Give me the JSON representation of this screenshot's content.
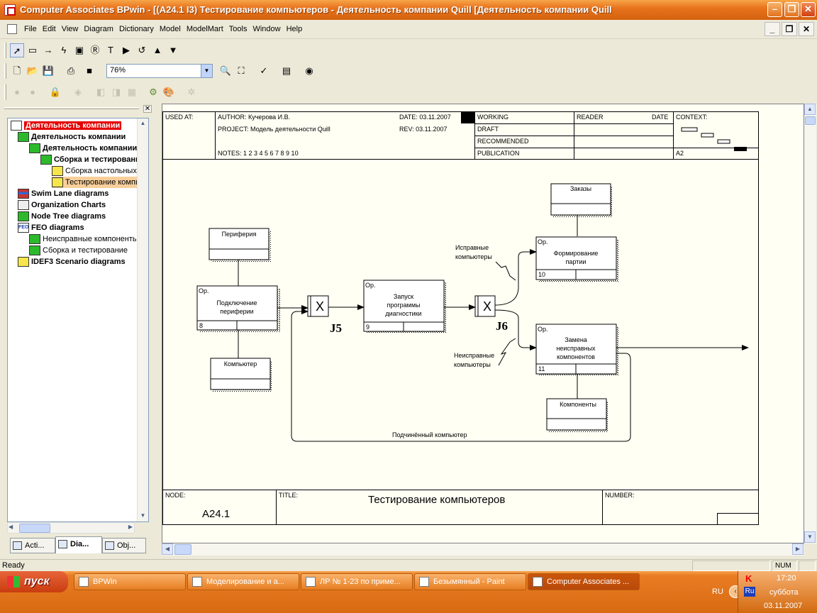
{
  "window": {
    "title": "Computer Associates BPwin - [(A24.1 I3) Тестирование компьютеров - Деятельность компании Quill  [Деятельность компании Quill"
  },
  "menu": [
    "File",
    "Edit",
    "View",
    "Diagram",
    "Dictionary",
    "Model",
    "ModelMart",
    "Tools",
    "Window",
    "Help"
  ],
  "toolbar": {
    "zoom": "76%"
  },
  "tree": {
    "items": [
      {
        "label": "Деятельность компании",
        "icon": "root"
      },
      {
        "label": "Деятельность компании",
        "icon": "green"
      },
      {
        "label": "Деятельность компании",
        "icon": "green"
      },
      {
        "label": "Сборка и тестирование",
        "icon": "green"
      },
      {
        "label": "Сборка настольных",
        "icon": "yellow"
      },
      {
        "label": "Тестирование компьютеров",
        "icon": "yellow"
      },
      {
        "label": "Swim Lane diagrams",
        "icon": "swim"
      },
      {
        "label": "Organization Charts",
        "icon": "org"
      },
      {
        "label": "Node Tree diagrams",
        "icon": "green"
      },
      {
        "label": "FEO diagrams",
        "icon": "feo"
      },
      {
        "label": "Неисправные компоненты",
        "icon": "green"
      },
      {
        "label": "Сборка и тестирование",
        "icon": "green"
      },
      {
        "label": "IDEF3 Scenario diagrams",
        "icon": "yellow"
      }
    ],
    "tabs": [
      "Acti...",
      "Dia...",
      "Obj..."
    ]
  },
  "frame": {
    "used_at": "USED AT:",
    "author": "AUTHOR:  Кучерова И.В.",
    "project": "PROJECT:  Модель деятельности Quill",
    "date": "DATE: 03.11.2007",
    "rev": "REV:    03.11.2007",
    "notes": "NOTES:  1  2  3  4  5  6  7  8  9  10",
    "working": "WORKING",
    "draft": "DRAFT",
    "recommended": "RECOMMENDED",
    "publication": "PUBLICATION",
    "reader": "READER",
    "date_col": "DATE",
    "context": "CONTEXT:",
    "context_node": "A2",
    "node_label": "NODE:",
    "node_value": "A24.1",
    "title_label": "TITLE:",
    "title_value": "Тестирование компьютеров",
    "number_label": "NUMBER:"
  },
  "diagram": {
    "objects": {
      "periferia": "Периферия",
      "kompyuter": "Компьютер",
      "zakazy": "Заказы",
      "komponenty": "Компоненты"
    },
    "units": {
      "u8": {
        "name": [
          "Подключение",
          "периферии"
        ],
        "num": "8",
        "tag": "Ор."
      },
      "u9": {
        "name": [
          "Запуск",
          "программы",
          "диагностики"
        ],
        "num": "9",
        "tag": "Ор."
      },
      "u10": {
        "name": [
          "Формирование",
          "партии"
        ],
        "num": "10",
        "tag": "Ор."
      },
      "u11": {
        "name": [
          "Замена",
          "неисправных",
          "компонентов"
        ],
        "num": "11",
        "tag": "Ор."
      }
    },
    "junctions": {
      "j5": {
        "symbol": "X",
        "label": "J5"
      },
      "j6": {
        "symbol": "X",
        "label": "J6"
      }
    },
    "labels": {
      "good": [
        "Исправные",
        "компьютеры"
      ],
      "bad": [
        "Неисправные",
        "компьютеры"
      ],
      "loop": "Подчинённый компьютер"
    }
  },
  "status": {
    "text": "Ready",
    "num": "NUM"
  },
  "taskbar": {
    "start": "пуск",
    "tasks": [
      "BPWin",
      "Моделирование и а...",
      "ЛР № 1-23 по приме...",
      "Безымянный - Paint",
      "Computer Associates ..."
    ],
    "lang": "RU",
    "time": "17:20",
    "day": "суббота",
    "date": "03.11.2007"
  },
  "colors": {
    "accent": "#e8731d",
    "canvas": "#fffff4",
    "highlight": "#e40000"
  }
}
